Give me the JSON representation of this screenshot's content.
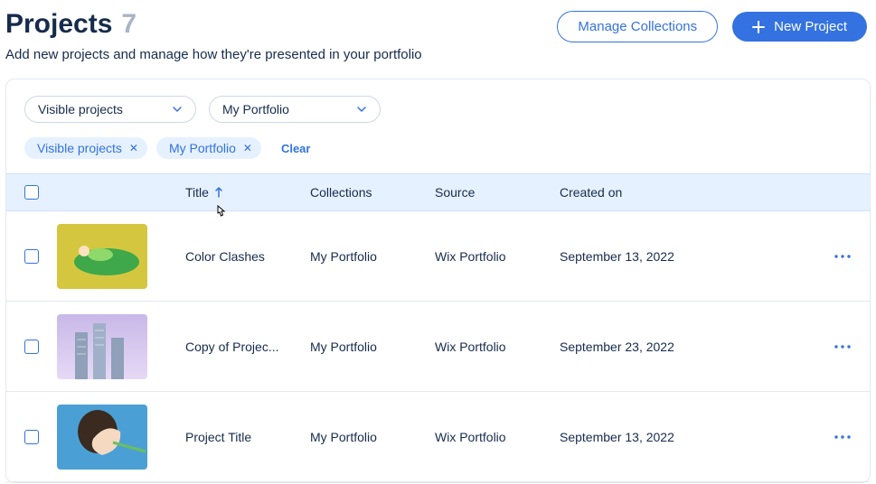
{
  "header": {
    "title": "Projects",
    "count": "7",
    "subtitle": "Add new projects and manage how they're presented in your portfolio",
    "manage_collections_label": "Manage Collections",
    "new_project_label": "New Project"
  },
  "filters": {
    "dropdown1": "Visible projects",
    "dropdown2": "My Portfolio",
    "chip1": "Visible projects",
    "chip2": "My Portfolio",
    "clear_label": "Clear"
  },
  "columns": {
    "title": "Title",
    "collections": "Collections",
    "source": "Source",
    "created_on": "Created on"
  },
  "rows": [
    {
      "title": "Color Clashes",
      "collections": "My Portfolio",
      "source": "Wix Portfolio",
      "created_on": "September 13, 2022"
    },
    {
      "title": "Copy of Projec...",
      "collections": "My Portfolio",
      "source": "Wix Portfolio",
      "created_on": "September 23, 2022"
    },
    {
      "title": "Project Title",
      "collections": "My Portfolio",
      "source": "Wix Portfolio",
      "created_on": "September 13, 2022"
    }
  ]
}
